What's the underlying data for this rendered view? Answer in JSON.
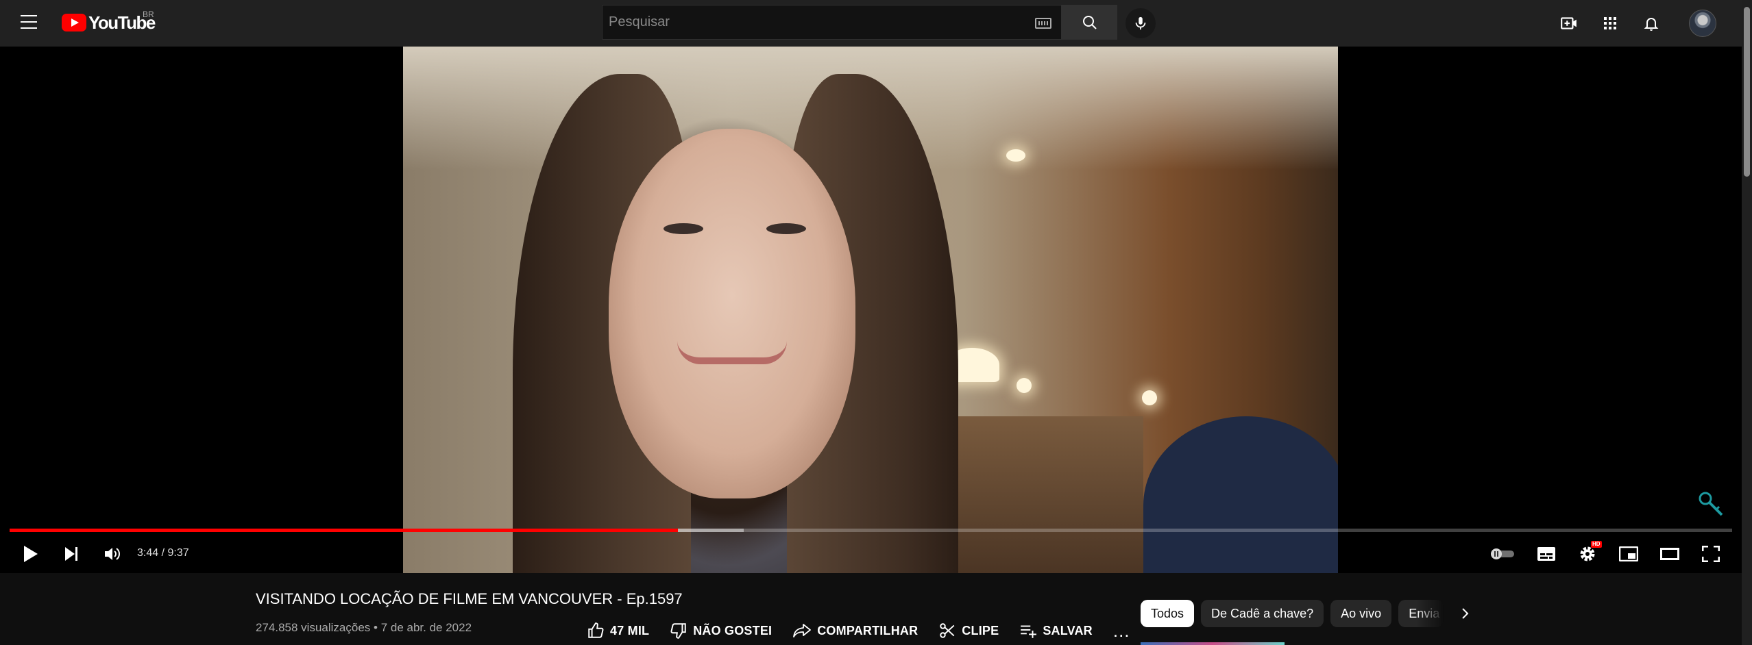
{
  "header": {
    "logo_text": "YouTube",
    "region": "BR",
    "search_placeholder": "Pesquisar",
    "icons": [
      "menu-icon",
      "keyboard-icon",
      "search-icon",
      "mic-icon",
      "create-icon",
      "apps-icon",
      "notifications-icon",
      "avatar"
    ]
  },
  "player": {
    "current_time": "3:44",
    "separator": " / ",
    "duration": "9:37",
    "played_fraction": 0.388,
    "buffered_fraction": 0.426,
    "colors": {
      "progress": "#ff0000"
    },
    "icons": [
      "play-icon",
      "next-icon",
      "volume-icon",
      "autoplay-toggle-icon",
      "subtitles-icon",
      "settings-icon",
      "miniplayer-icon",
      "theater-icon",
      "fullscreen-icon"
    ],
    "settings_badge": "HD"
  },
  "video": {
    "title": "VISITANDO LOCAÇÃO DE FILME EM VANCOUVER - Ep.1597",
    "views": "274.858 visualizações",
    "dot": " • ",
    "date": "7 de abr. de 2022"
  },
  "actions": {
    "like": "47 MIL",
    "dislike": "NÃO GOSTEI",
    "share": "COMPARTILHAR",
    "clip": "CLIPE",
    "save": "SALVAR",
    "more": "..."
  },
  "chips": [
    "Todos",
    "De Cadê a chave?",
    "Ao vivo",
    "Envia"
  ]
}
